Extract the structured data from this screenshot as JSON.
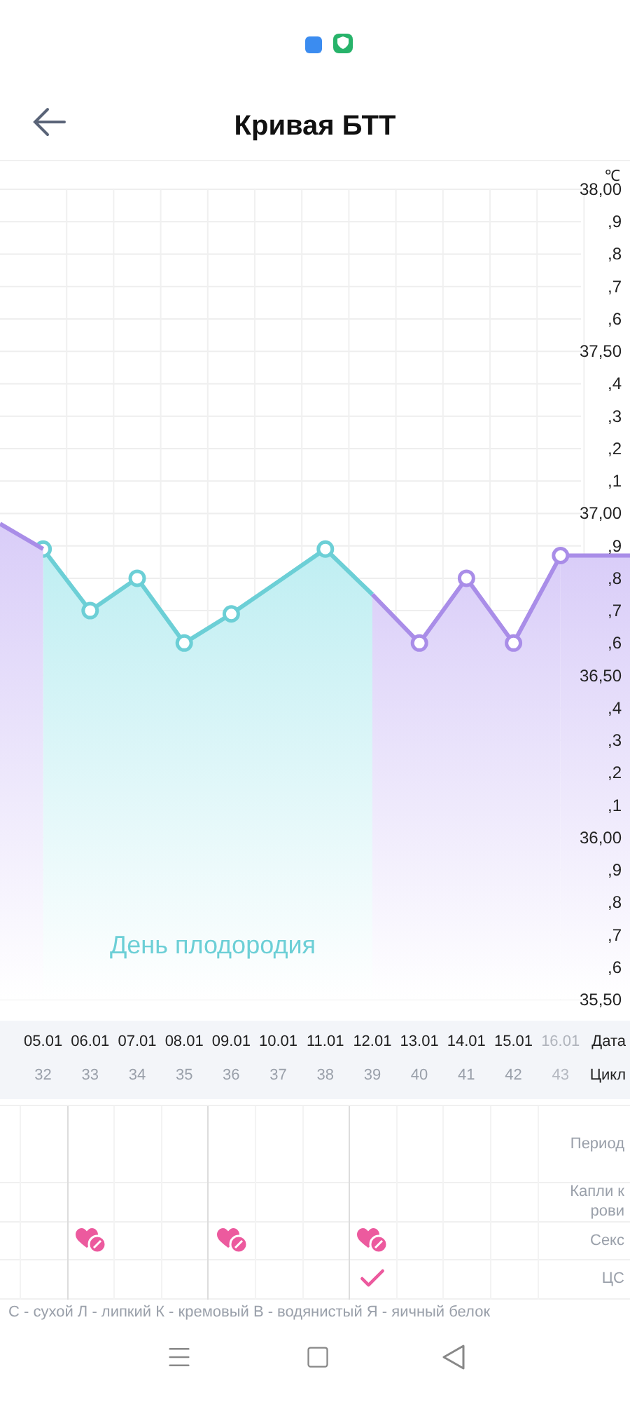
{
  "header": {
    "title": "Кривая БТТ"
  },
  "chart": {
    "unit": "℃",
    "minor_labels": [
      ",9",
      ",8",
      ",7",
      ",6",
      ",4",
      ",3",
      ",2",
      ",1",
      ",9",
      ",8",
      ",7",
      ",6",
      ",4",
      ",3",
      ",2",
      ",1",
      ",9",
      ",8",
      ",7",
      ",6"
    ],
    "chart_data": {
      "type": "area",
      "grid": true,
      "categories": [
        "05.01",
        "06.01",
        "07.01",
        "08.01",
        "09.01",
        "10.01",
        "11.01",
        "12.01",
        "13.01",
        "14.01",
        "15.01",
        "16.01"
      ],
      "series": [
        {
          "name": "День плодородия",
          "color": "#6ccfd6",
          "values": [
            36.89,
            36.7,
            36.8,
            36.6,
            36.69,
            36.79,
            36.89,
            36.75,
            null,
            null,
            null,
            null
          ]
        },
        {
          "color": "#a98de8",
          "values": [
            null,
            null,
            null,
            null,
            null,
            null,
            null,
            36.75,
            36.6,
            36.8,
            36.6,
            36.87
          ]
        }
      ],
      "ylim": [
        35.5,
        38.0
      ],
      "yticks": [
        {
          "value": 38.0,
          "label": "38,00"
        },
        {
          "value": 37.5,
          "label": "37,50"
        },
        {
          "value": 37.0,
          "label": "37,00"
        },
        {
          "value": 36.5,
          "label": "36,50"
        },
        {
          "value": 36.0,
          "label": "36,00"
        },
        {
          "value": 35.5,
          "label": "35,50"
        }
      ]
    }
  },
  "row_labels": {
    "date": "Дата",
    "cycle": "Цикл"
  },
  "days": [
    {
      "cycle": "32",
      "measured": true,
      "faded": false,
      "sex": false,
      "cs": false
    },
    {
      "cycle": "33",
      "measured": true,
      "faded": false,
      "sex": true,
      "cs": false
    },
    {
      "cycle": "34",
      "measured": true,
      "faded": false,
      "sex": false,
      "cs": false
    },
    {
      "cycle": "35",
      "measured": true,
      "faded": false,
      "sex": false,
      "cs": false
    },
    {
      "cycle": "36",
      "measured": true,
      "faded": false,
      "sex": true,
      "cs": false
    },
    {
      "cycle": "37",
      "measured": false,
      "faded": false,
      "sex": false,
      "cs": false
    },
    {
      "cycle": "38",
      "measured": true,
      "faded": false,
      "sex": false,
      "cs": false
    },
    {
      "cycle": "39",
      "measured": false,
      "faded": false,
      "sex": true,
      "cs": true
    },
    {
      "cycle": "40",
      "measured": true,
      "faded": false,
      "sex": false,
      "cs": false
    },
    {
      "cycle": "41",
      "measured": true,
      "faded": false,
      "sex": false,
      "cs": false
    },
    {
      "cycle": "42",
      "measured": true,
      "faded": false,
      "sex": false,
      "cs": false
    },
    {
      "cycle": "43",
      "measured": true,
      "faded": true
    }
  ],
  "event_rows": [
    {
      "kind": "period",
      "label": "Период"
    },
    {
      "kind": "drops",
      "label": "Капли крови"
    },
    {
      "kind": "sex",
      "label": "Секс"
    },
    {
      "kind": "cs",
      "label": "ЦС"
    }
  ],
  "legend": "С - сухой Л - липкий К - кремовый В - водянистый Я - яичный белок"
}
